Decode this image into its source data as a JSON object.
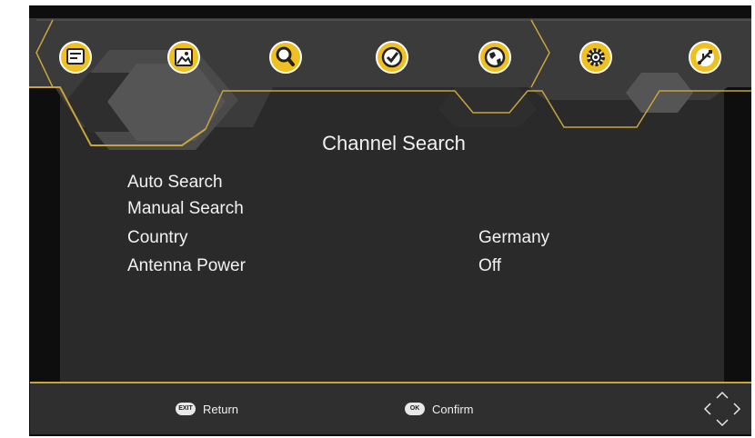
{
  "menu": {
    "icons": [
      {
        "name": "program-icon"
      },
      {
        "name": "picture-icon"
      },
      {
        "name": "search-icon"
      },
      {
        "name": "clock-icon"
      },
      {
        "name": "globe-icon"
      },
      {
        "name": "gear-icon"
      },
      {
        "name": "usb-icon"
      }
    ],
    "selected_index": 2
  },
  "page": {
    "title": "Channel Search"
  },
  "items": [
    {
      "label": "Auto Search",
      "value": ""
    },
    {
      "label": "Manual Search",
      "value": ""
    },
    {
      "label": "Country",
      "value": "Germany"
    },
    {
      "label": "Antenna Power",
      "value": "Off"
    }
  ],
  "footer": {
    "exit_key": "EXIT",
    "exit_label": "Return",
    "ok_key": "OK",
    "ok_label": "Confirm"
  },
  "colors": {
    "accent": "#c8a43c",
    "icon_yellow": "#f0c020",
    "background": "#2a2a2a"
  }
}
